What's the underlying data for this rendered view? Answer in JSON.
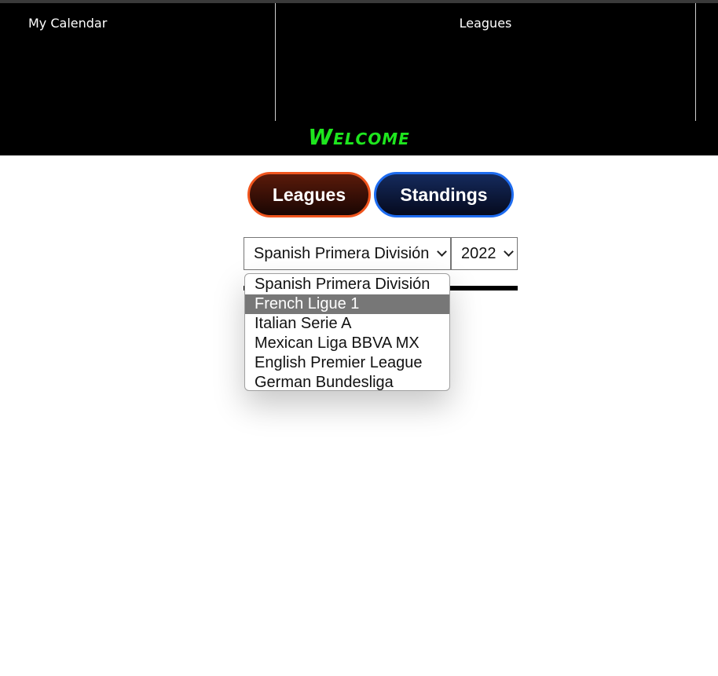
{
  "nav": {
    "items": [
      {
        "label": "My Calendar"
      },
      {
        "label": "Leagues"
      }
    ]
  },
  "banner": {
    "welcome": "Welcome",
    "color": "#1ee61e"
  },
  "tabs": {
    "leagues_label": "Leagues",
    "standings_label": "Standings",
    "leagues_border_color": "#f0551e",
    "standings_border_color": "#1e6cf0"
  },
  "filters": {
    "league_selected": "Spanish Primera División",
    "year_selected": "2022",
    "league_options": [
      "Spanish Primera División",
      "French Ligue 1",
      "Italian Serie A",
      "Mexican Liga BBVA MX",
      "English Premier League",
      "German Bundesliga"
    ],
    "highlighted_option": "French Ligue 1"
  }
}
